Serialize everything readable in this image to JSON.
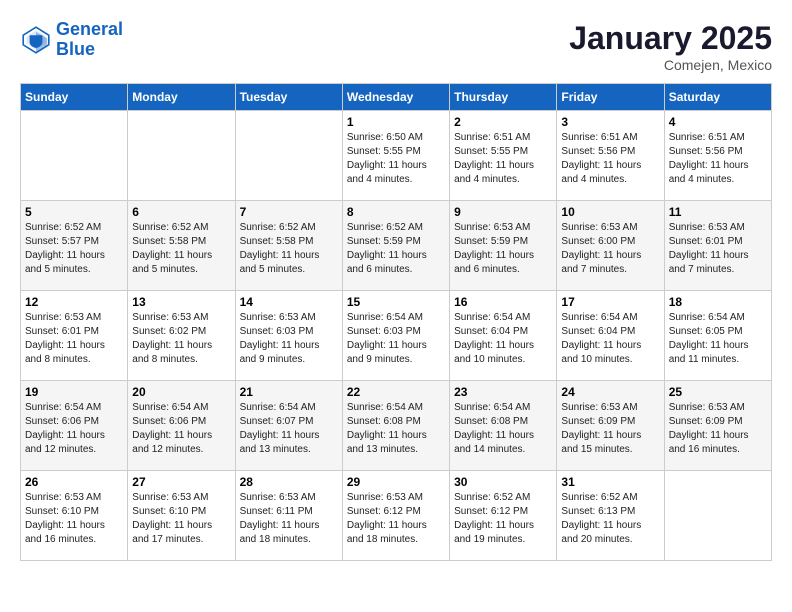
{
  "header": {
    "logo_line1": "General",
    "logo_line2": "Blue",
    "month": "January 2025",
    "location": "Comejen, Mexico"
  },
  "weekdays": [
    "Sunday",
    "Monday",
    "Tuesday",
    "Wednesday",
    "Thursday",
    "Friday",
    "Saturday"
  ],
  "weeks": [
    [
      {
        "day": "",
        "info": ""
      },
      {
        "day": "",
        "info": ""
      },
      {
        "day": "",
        "info": ""
      },
      {
        "day": "1",
        "info": "Sunrise: 6:50 AM\nSunset: 5:55 PM\nDaylight: 11 hours\nand 4 minutes."
      },
      {
        "day": "2",
        "info": "Sunrise: 6:51 AM\nSunset: 5:55 PM\nDaylight: 11 hours\nand 4 minutes."
      },
      {
        "day": "3",
        "info": "Sunrise: 6:51 AM\nSunset: 5:56 PM\nDaylight: 11 hours\nand 4 minutes."
      },
      {
        "day": "4",
        "info": "Sunrise: 6:51 AM\nSunset: 5:56 PM\nDaylight: 11 hours\nand 4 minutes."
      }
    ],
    [
      {
        "day": "5",
        "info": "Sunrise: 6:52 AM\nSunset: 5:57 PM\nDaylight: 11 hours\nand 5 minutes."
      },
      {
        "day": "6",
        "info": "Sunrise: 6:52 AM\nSunset: 5:58 PM\nDaylight: 11 hours\nand 5 minutes."
      },
      {
        "day": "7",
        "info": "Sunrise: 6:52 AM\nSunset: 5:58 PM\nDaylight: 11 hours\nand 5 minutes."
      },
      {
        "day": "8",
        "info": "Sunrise: 6:52 AM\nSunset: 5:59 PM\nDaylight: 11 hours\nand 6 minutes."
      },
      {
        "day": "9",
        "info": "Sunrise: 6:53 AM\nSunset: 5:59 PM\nDaylight: 11 hours\nand 6 minutes."
      },
      {
        "day": "10",
        "info": "Sunrise: 6:53 AM\nSunset: 6:00 PM\nDaylight: 11 hours\nand 7 minutes."
      },
      {
        "day": "11",
        "info": "Sunrise: 6:53 AM\nSunset: 6:01 PM\nDaylight: 11 hours\nand 7 minutes."
      }
    ],
    [
      {
        "day": "12",
        "info": "Sunrise: 6:53 AM\nSunset: 6:01 PM\nDaylight: 11 hours\nand 8 minutes."
      },
      {
        "day": "13",
        "info": "Sunrise: 6:53 AM\nSunset: 6:02 PM\nDaylight: 11 hours\nand 8 minutes."
      },
      {
        "day": "14",
        "info": "Sunrise: 6:53 AM\nSunset: 6:03 PM\nDaylight: 11 hours\nand 9 minutes."
      },
      {
        "day": "15",
        "info": "Sunrise: 6:54 AM\nSunset: 6:03 PM\nDaylight: 11 hours\nand 9 minutes."
      },
      {
        "day": "16",
        "info": "Sunrise: 6:54 AM\nSunset: 6:04 PM\nDaylight: 11 hours\nand 10 minutes."
      },
      {
        "day": "17",
        "info": "Sunrise: 6:54 AM\nSunset: 6:04 PM\nDaylight: 11 hours\nand 10 minutes."
      },
      {
        "day": "18",
        "info": "Sunrise: 6:54 AM\nSunset: 6:05 PM\nDaylight: 11 hours\nand 11 minutes."
      }
    ],
    [
      {
        "day": "19",
        "info": "Sunrise: 6:54 AM\nSunset: 6:06 PM\nDaylight: 11 hours\nand 12 minutes."
      },
      {
        "day": "20",
        "info": "Sunrise: 6:54 AM\nSunset: 6:06 PM\nDaylight: 11 hours\nand 12 minutes."
      },
      {
        "day": "21",
        "info": "Sunrise: 6:54 AM\nSunset: 6:07 PM\nDaylight: 11 hours\nand 13 minutes."
      },
      {
        "day": "22",
        "info": "Sunrise: 6:54 AM\nSunset: 6:08 PM\nDaylight: 11 hours\nand 13 minutes."
      },
      {
        "day": "23",
        "info": "Sunrise: 6:54 AM\nSunset: 6:08 PM\nDaylight: 11 hours\nand 14 minutes."
      },
      {
        "day": "24",
        "info": "Sunrise: 6:53 AM\nSunset: 6:09 PM\nDaylight: 11 hours\nand 15 minutes."
      },
      {
        "day": "25",
        "info": "Sunrise: 6:53 AM\nSunset: 6:09 PM\nDaylight: 11 hours\nand 16 minutes."
      }
    ],
    [
      {
        "day": "26",
        "info": "Sunrise: 6:53 AM\nSunset: 6:10 PM\nDaylight: 11 hours\nand 16 minutes."
      },
      {
        "day": "27",
        "info": "Sunrise: 6:53 AM\nSunset: 6:10 PM\nDaylight: 11 hours\nand 17 minutes."
      },
      {
        "day": "28",
        "info": "Sunrise: 6:53 AM\nSunset: 6:11 PM\nDaylight: 11 hours\nand 18 minutes."
      },
      {
        "day": "29",
        "info": "Sunrise: 6:53 AM\nSunset: 6:12 PM\nDaylight: 11 hours\nand 18 minutes."
      },
      {
        "day": "30",
        "info": "Sunrise: 6:52 AM\nSunset: 6:12 PM\nDaylight: 11 hours\nand 19 minutes."
      },
      {
        "day": "31",
        "info": "Sunrise: 6:52 AM\nSunset: 6:13 PM\nDaylight: 11 hours\nand 20 minutes."
      },
      {
        "day": "",
        "info": ""
      }
    ]
  ]
}
